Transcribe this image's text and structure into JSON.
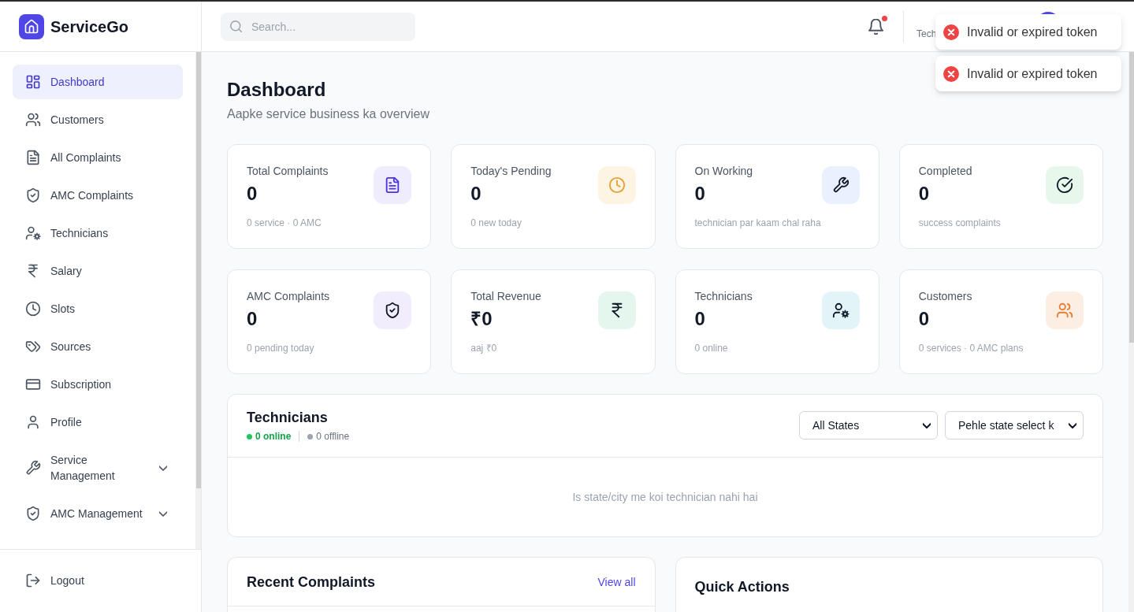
{
  "app": {
    "name": "ServiceGo"
  },
  "sidebar": {
    "items": [
      {
        "label": "Dashboard",
        "kind": "link",
        "selected": true
      },
      {
        "label": "Customers",
        "kind": "link",
        "selected": false
      },
      {
        "label": "All Complaints",
        "kind": "link",
        "selected": false
      },
      {
        "label": "AMC Complaints",
        "kind": "link",
        "selected": false
      },
      {
        "label": "Technicians",
        "kind": "link",
        "selected": false
      },
      {
        "label": "Salary",
        "kind": "link",
        "selected": false
      },
      {
        "label": "Slots",
        "kind": "link",
        "selected": false
      },
      {
        "label": "Sources",
        "kind": "link",
        "selected": false
      },
      {
        "label": "Subscription",
        "kind": "link",
        "selected": false
      },
      {
        "label": "Profile",
        "kind": "link",
        "selected": false
      },
      {
        "label": "Service Management",
        "kind": "group",
        "selected": false,
        "expanded": false
      },
      {
        "label": "AMC Management",
        "kind": "group",
        "selected": false,
        "expanded": false
      }
    ],
    "footer": {
      "label": "Logout"
    }
  },
  "header": {
    "search": {
      "placeholder": "Search..."
    },
    "notifications": {
      "unread": true
    },
    "user": {
      "role": "Tech"
    }
  },
  "toasts": [
    {
      "message": "Invalid or expired token",
      "kind": "error"
    },
    {
      "message": "Invalid or expired token",
      "kind": "error"
    }
  ],
  "page": {
    "title": "Dashboard",
    "subtitle": "Aapke service business ka overview"
  },
  "stats": [
    {
      "label": "Total Complaints",
      "value": "0",
      "note": "0 service · 0 AMC",
      "color": "#efedfd",
      "kind": "accent"
    },
    {
      "label": "Today's Pending",
      "value": "0",
      "note": "0 new today",
      "color": "#fef4e4",
      "kind": "accent"
    },
    {
      "label": "On Working",
      "value": "0",
      "note": "technician par kaam chal raha",
      "color": "#e9f0fe",
      "kind": "plain"
    },
    {
      "label": "Completed",
      "value": "0",
      "note": "success complaints",
      "color": "#e7f7ec",
      "kind": "plain"
    },
    {
      "label": "AMC Complaints",
      "value": "0",
      "note": "0 pending today",
      "color": "#f1edfd",
      "kind": "plain"
    },
    {
      "label": "Total Revenue",
      "value": "₹0",
      "note": "aaj ₹0",
      "color": "#e5f6ee",
      "kind": "plain"
    },
    {
      "label": "Technicians",
      "value": "0",
      "note": "0 online",
      "color": "#e2f4f8",
      "kind": "plain"
    },
    {
      "label": "Customers",
      "value": "0",
      "note": "0 services · 0 AMC plans",
      "color": "#fdeee3",
      "kind": "accent"
    }
  ],
  "technicians": {
    "title": "Technicians",
    "online": "0 online",
    "offline": "0 offline",
    "filters": [
      {
        "value": "All States"
      },
      {
        "value": "Pehle state select k"
      }
    ],
    "empty_message": "Is state/city me koi technician nahi hai"
  },
  "recent_complaints": {
    "title": "Recent Complaints",
    "link": "View all"
  },
  "quick_actions": {
    "title": "Quick Actions"
  }
}
